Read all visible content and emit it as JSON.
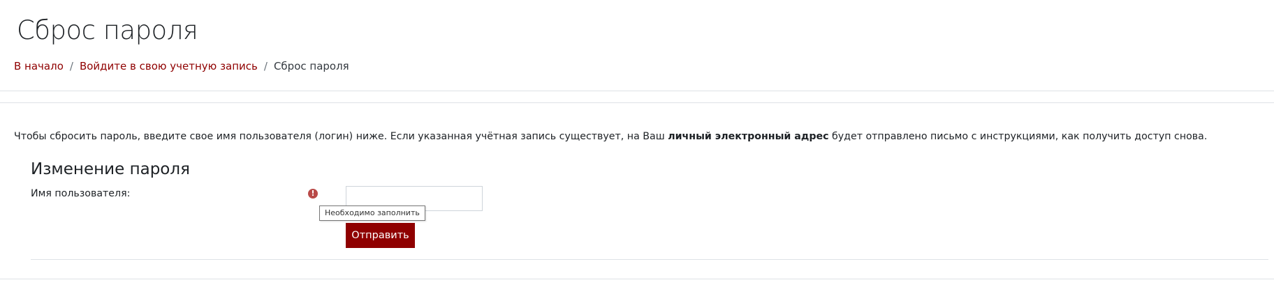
{
  "page": {
    "title": "Сброс пароля"
  },
  "breadcrumb": {
    "items": [
      {
        "label": "В начало"
      },
      {
        "label": "Войдите в свою учетную запись"
      },
      {
        "label": "Сброс пароля"
      }
    ],
    "separator": "/"
  },
  "intro": {
    "text_before": "Чтобы сбросить пароль, введите свое имя пользователя (логин) ниже. Если указанная учётная запись существует, на Ваш ",
    "bold": "личный электронный адрес",
    "text_after": " будет отправлено письмо с инструкциями, как получить доступ снова."
  },
  "form": {
    "legend": "Изменение пароля",
    "username_label": "Имя пользователя:",
    "username_value": "",
    "required_icon": "exclamation-circle-icon",
    "tooltip": "Необходимо заполнить",
    "submit_label": "Отправить"
  },
  "colors": {
    "accent": "#8f0000",
    "required": "#b94a48",
    "border": "#dee2e6"
  }
}
